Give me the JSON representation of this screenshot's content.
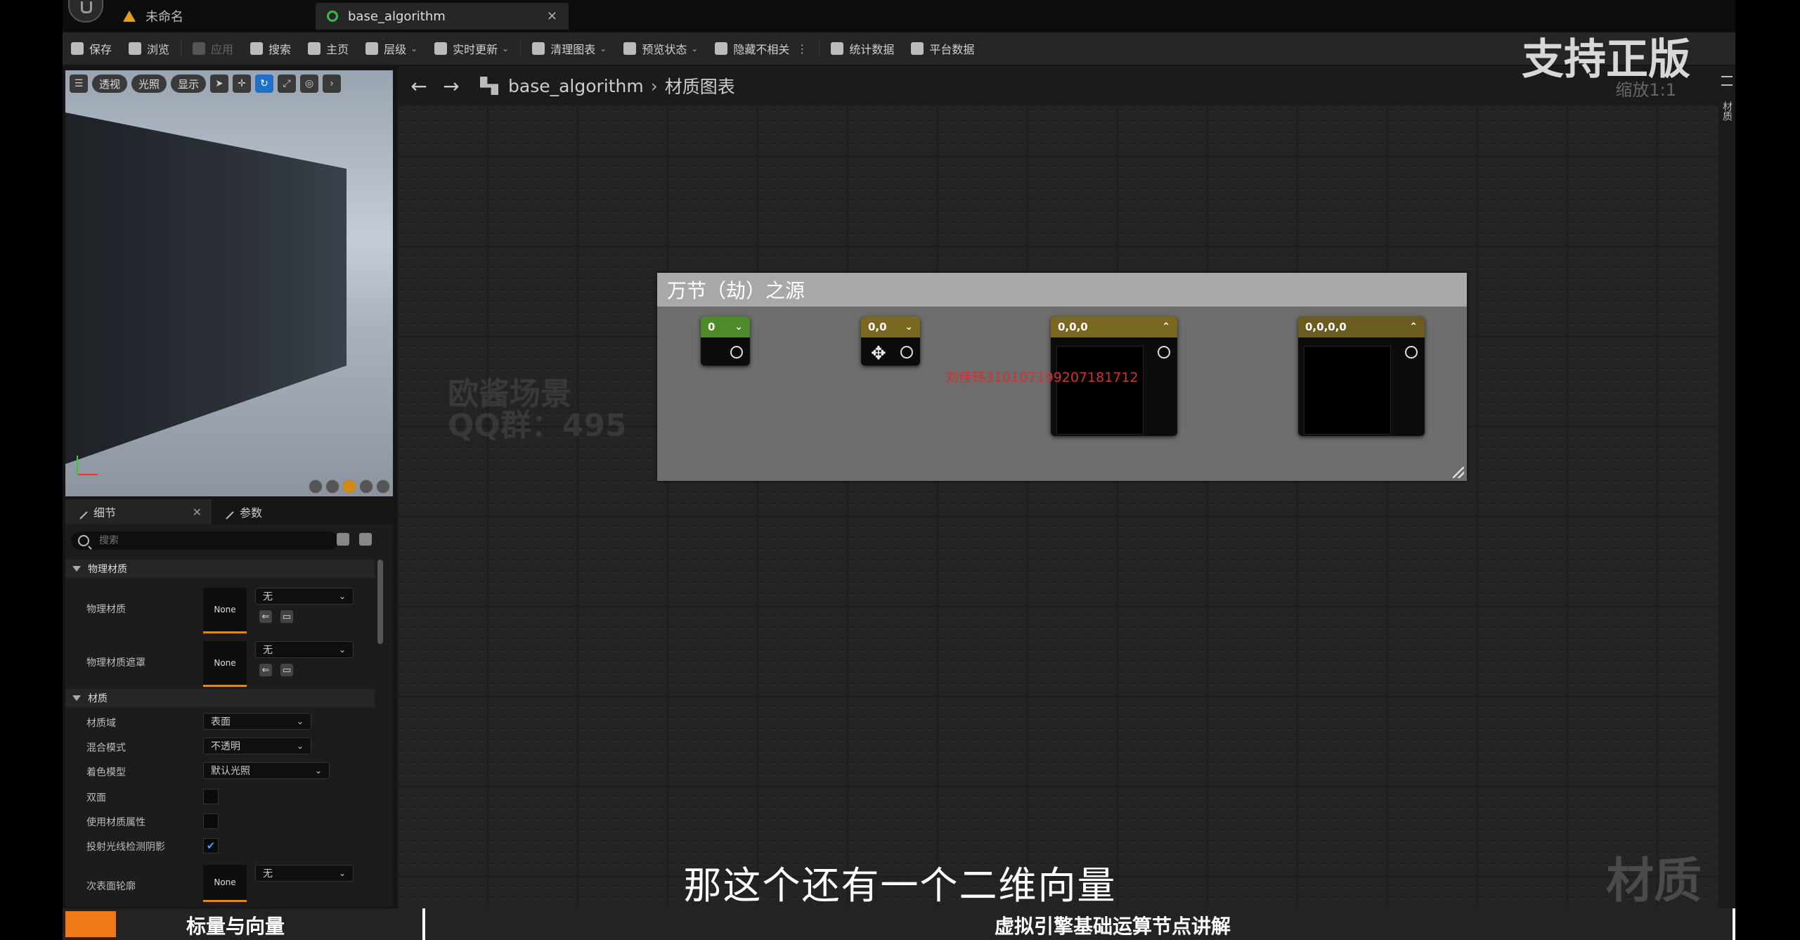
{
  "tabs": [
    {
      "label": "未命名",
      "icon": "warning-icon"
    },
    {
      "label": "base_algorithm",
      "icon": "material-icon",
      "active": true
    }
  ],
  "toolbar": [
    {
      "label": "保存",
      "icon": "save-icon"
    },
    {
      "label": "浏览",
      "icon": "browse-icon"
    },
    {
      "label": "应用",
      "icon": "apply-icon",
      "disabled": true
    },
    {
      "label": "搜索",
      "icon": "search-icon"
    },
    {
      "label": "主页",
      "icon": "home-icon"
    },
    {
      "label": "层级",
      "icon": "hierarchy-icon",
      "dropdown": true
    },
    {
      "label": "实时更新",
      "icon": "live-update-icon",
      "dropdown": true
    },
    {
      "label": "清理图表",
      "icon": "clean-graph-icon",
      "dropdown": true
    },
    {
      "label": "预览状态",
      "icon": "preview-state-icon",
      "dropdown": true
    },
    {
      "label": "隐藏不相关",
      "icon": "hide-unrelated-icon"
    },
    {
      "label": "统计数据",
      "icon": "stats-icon"
    },
    {
      "label": "平台数据",
      "icon": "platform-stats-icon"
    }
  ],
  "viewport": {
    "buttons": [
      "透视",
      "光照",
      "显示"
    ]
  },
  "details": {
    "tab_details": "细节",
    "tab_params": "参数",
    "search_placeholder": "搜索",
    "categories": {
      "physical": "物理材质",
      "material": "材质"
    },
    "phys_material": {
      "label": "物理材质",
      "thumb": "None",
      "value": "无"
    },
    "phys_mask": {
      "label": "物理材质遮罩",
      "thumb": "None",
      "value": "无"
    },
    "material_domain": {
      "label": "材质域",
      "value": "表面"
    },
    "blend_mode": {
      "label": "混合模式",
      "value": "不透明"
    },
    "shading_model": {
      "label": "着色模型",
      "value": "默认光照"
    },
    "two_sided": {
      "label": "双面",
      "checked": false
    },
    "use_material_attributes": {
      "label": "使用材质属性",
      "checked": false
    },
    "cast_ray_traced_shadows": {
      "label": "投射光线检测阴影",
      "checked": true
    },
    "subsurface_profile": {
      "label": "次表面轮廓",
      "thumb": "None",
      "value": "无"
    }
  },
  "graph": {
    "breadcrumb_root": "base_algorithm",
    "breadcrumb_child": "材质图表",
    "zoom": "缩放1:1",
    "brand_watermark": "支持正版",
    "corner_watermark": "材质",
    "comment_title": "万节（劫）之源",
    "nodes": [
      {
        "value": "0",
        "color": "#4f8a2a"
      },
      {
        "value": "0,0",
        "color": "#7a6820"
      },
      {
        "value": "0,0,0",
        "color": "#7a6820"
      },
      {
        "value": "0,0,0,0",
        "color": "#6a5c1e"
      }
    ],
    "red_watermark": "刘佳玮310107199207181712",
    "faint_watermark_1": "欧酱场景",
    "faint_watermark_2": "QQ群：495"
  },
  "rightbar_label": "材质",
  "subtitle": "那这个还有一个二维向量",
  "banner": {
    "left": "标量与向量",
    "right": "虚拟引擎基础运算节点讲解"
  }
}
